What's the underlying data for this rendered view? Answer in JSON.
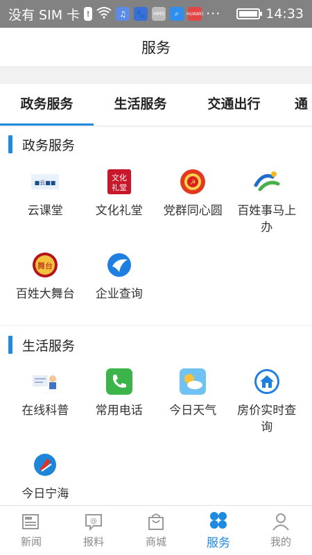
{
  "status": {
    "carrier": "没有 SIM 卡",
    "time": "14:33",
    "notif_hms": "HMS"
  },
  "header": {
    "title": "服务"
  },
  "tabs": [
    {
      "label": "政务服务"
    },
    {
      "label": "生活服务"
    },
    {
      "label": "交通出行"
    },
    {
      "label": "通"
    }
  ],
  "sections": [
    {
      "title": "政务服务",
      "items": [
        {
          "label": "云课堂",
          "icon": "cloud-classroom-icon"
        },
        {
          "label": "文化礼堂",
          "icon": "culture-hall-icon"
        },
        {
          "label": "党群同心圆",
          "icon": "party-icon"
        },
        {
          "label": "百姓事马上办",
          "icon": "civic-affairs-icon"
        },
        {
          "label": "百姓大舞台",
          "icon": "stage-icon"
        },
        {
          "label": "企业查询",
          "icon": "enterprise-query-icon"
        }
      ]
    },
    {
      "title": "生活服务",
      "items": [
        {
          "label": "在线科普",
          "icon": "science-icon"
        },
        {
          "label": "常用电话",
          "icon": "phone-icon"
        },
        {
          "label": "今日天气",
          "icon": "weather-icon"
        },
        {
          "label": "房价实时查询",
          "icon": "house-price-icon"
        },
        {
          "label": "今日宁海",
          "icon": "ninghai-icon"
        }
      ]
    }
  ],
  "bottom_nav": [
    {
      "label": "新闻",
      "icon": "newspaper-icon"
    },
    {
      "label": "报料",
      "icon": "report-icon"
    },
    {
      "label": "商城",
      "icon": "shopping-bag-icon"
    },
    {
      "label": "服务",
      "icon": "clover-icon"
    },
    {
      "label": "我的",
      "icon": "user-icon"
    }
  ],
  "colors": {
    "accent": "#1e8ae0",
    "statusbar": "#828282"
  }
}
